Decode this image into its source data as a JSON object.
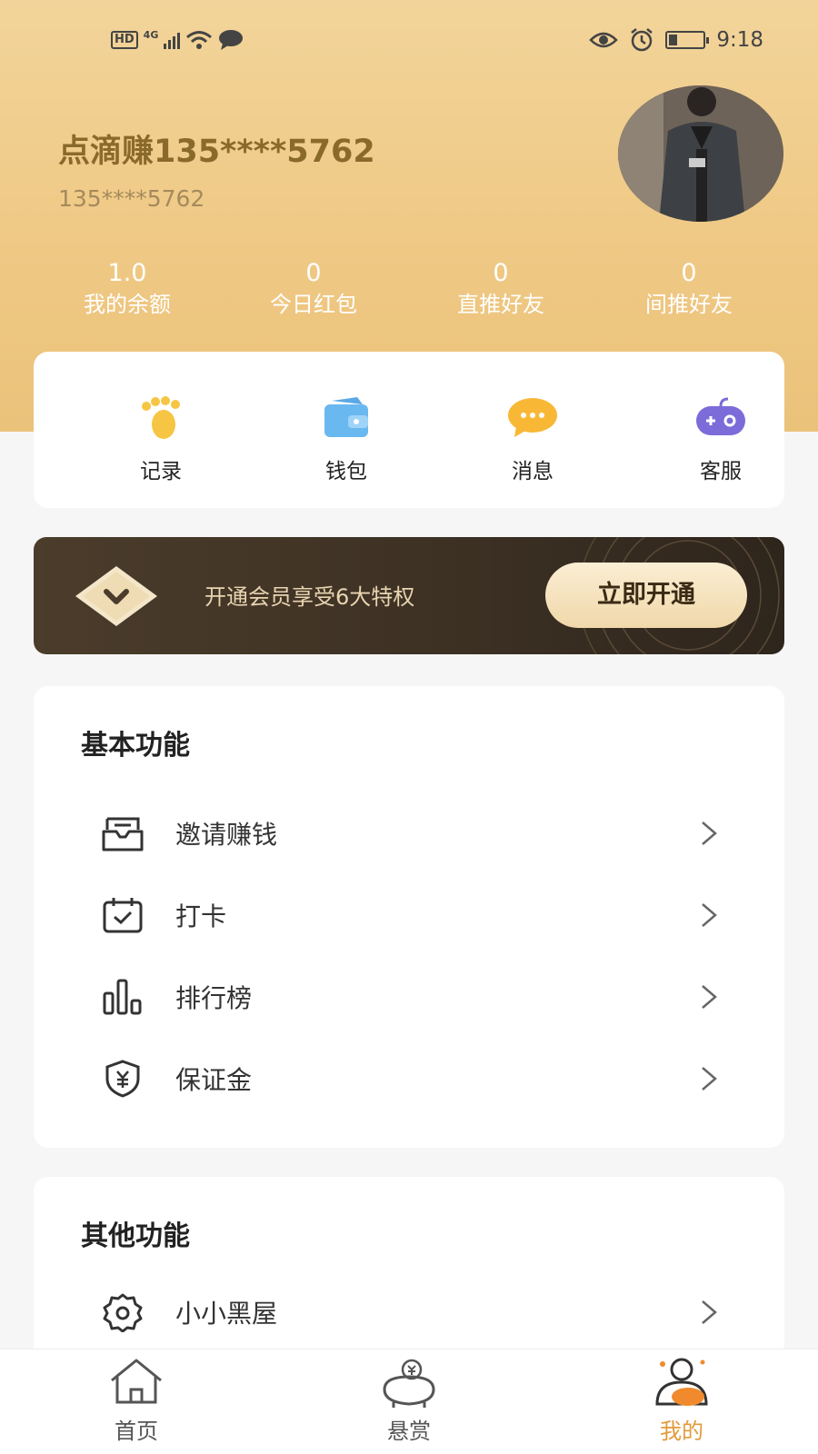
{
  "status_bar": {
    "time": "9:18",
    "hd": "HD",
    "network": "4G"
  },
  "profile": {
    "name": "点滴赚135****5762",
    "phone": "135****5762"
  },
  "stats": [
    {
      "value": "1.0",
      "label": "我的余额"
    },
    {
      "value": "0",
      "label": "今日红包"
    },
    {
      "value": "0",
      "label": "直推好友"
    },
    {
      "value": "0",
      "label": "间推好友"
    }
  ],
  "quick_actions": [
    {
      "label": "记录",
      "icon": "footprint-icon"
    },
    {
      "label": "钱包",
      "icon": "wallet-icon"
    },
    {
      "label": "消息",
      "icon": "chat-bubble-icon"
    },
    {
      "label": "客服",
      "icon": "gamepad-icon"
    }
  ],
  "vip": {
    "text": "开通会员享受6大特权",
    "button": "立即开通"
  },
  "basic": {
    "title": "基本功能",
    "items": [
      {
        "label": "邀请赚钱",
        "icon": "inbox-icon"
      },
      {
        "label": "打卡",
        "icon": "calendar-check-icon"
      },
      {
        "label": "排行榜",
        "icon": "bar-chart-icon"
      },
      {
        "label": "保证金",
        "icon": "shield-yen-icon"
      }
    ]
  },
  "other": {
    "title": "其他功能",
    "items": [
      {
        "label": "小小黑屋",
        "icon": "gear-icon"
      }
    ]
  },
  "tabs": [
    {
      "label": "首页",
      "icon": "home-icon",
      "active": false
    },
    {
      "label": "悬赏",
      "icon": "piggy-bank-icon",
      "active": false
    },
    {
      "label": "我的",
      "icon": "user-icon",
      "active": true
    }
  ],
  "colors": {
    "header": "#efc985",
    "accent": "#e09b3a",
    "vip_bg": "#3d3124",
    "name": "#8a6a2c"
  }
}
